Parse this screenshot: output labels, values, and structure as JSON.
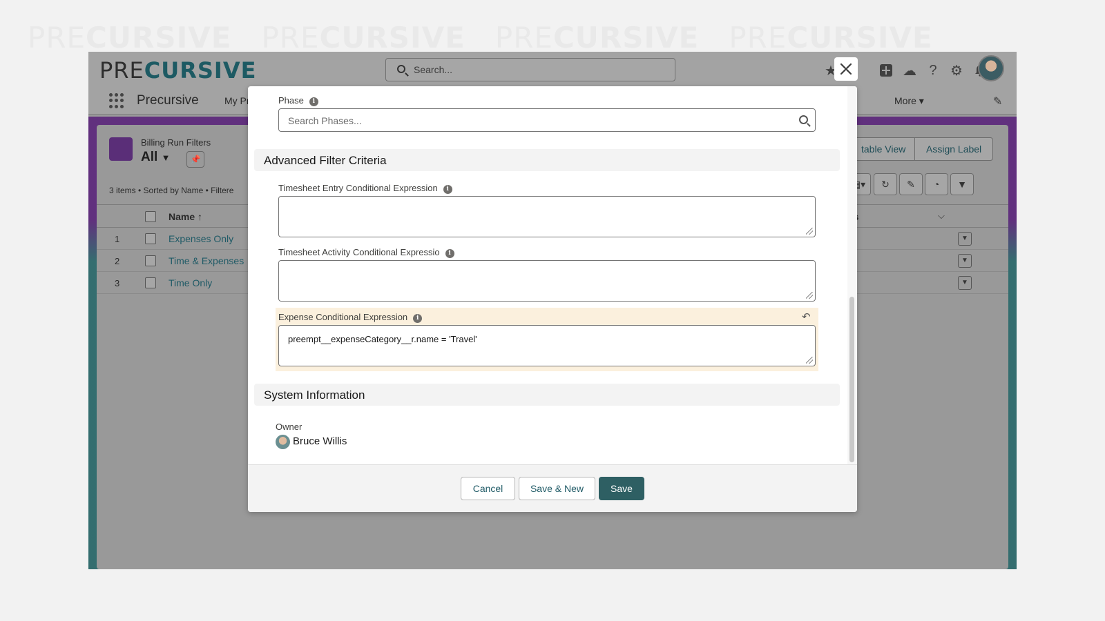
{
  "watermark": {
    "pre": "PRE",
    "bold": "CURSIVE"
  },
  "app": {
    "logo_pre": "PRE",
    "logo_bold": "CURSIVE",
    "search_placeholder": "Search...",
    "app_name": "Precursive",
    "nav_tab_partial": "My Pr",
    "nav_more": "More"
  },
  "list": {
    "object_title": "Billing Run Filters",
    "view_name": "All",
    "meta": "3 items • Sorted by Name • Filtere",
    "btn_editable_view": "table View",
    "btn_assign_label": "Assign Label",
    "col_name": "Name ↑",
    "col_right_partial": "ses",
    "rows": [
      {
        "num": "1",
        "name": "Expenses Only"
      },
      {
        "num": "2",
        "name": "Time & Expenses"
      },
      {
        "num": "3",
        "name": "Time Only"
      }
    ]
  },
  "modal": {
    "phase_label": "Phase",
    "phase_placeholder": "Search Phases...",
    "section_advanced": "Advanced Filter Criteria",
    "timesheet_entry_label": "Timesheet Entry Conditional Expression",
    "timesheet_activity_label": "Timesheet Activity Conditional Expressio",
    "expense_label": "Expense Conditional Expression",
    "expense_value": "preempt__expenseCategory__r.name = 'Travel'",
    "section_system": "System Information",
    "owner_label": "Owner",
    "owner_name": "Bruce Willis",
    "cancel": "Cancel",
    "save_new": "Save & New",
    "save": "Save"
  },
  "colors": {
    "brand": "#2e5f63",
    "link": "#1f5a66",
    "changed_bg": "#fbf0dd",
    "purple": "#5e2b7c",
    "teal": "#2f6b6d"
  },
  "icons": [
    "search-icon",
    "star-icon",
    "plus-icon",
    "cloud-icon",
    "help-icon",
    "gear-icon",
    "bell-icon",
    "close-icon",
    "info-icon",
    "undo-icon",
    "pin-icon",
    "refresh-icon",
    "filter-icon"
  ]
}
